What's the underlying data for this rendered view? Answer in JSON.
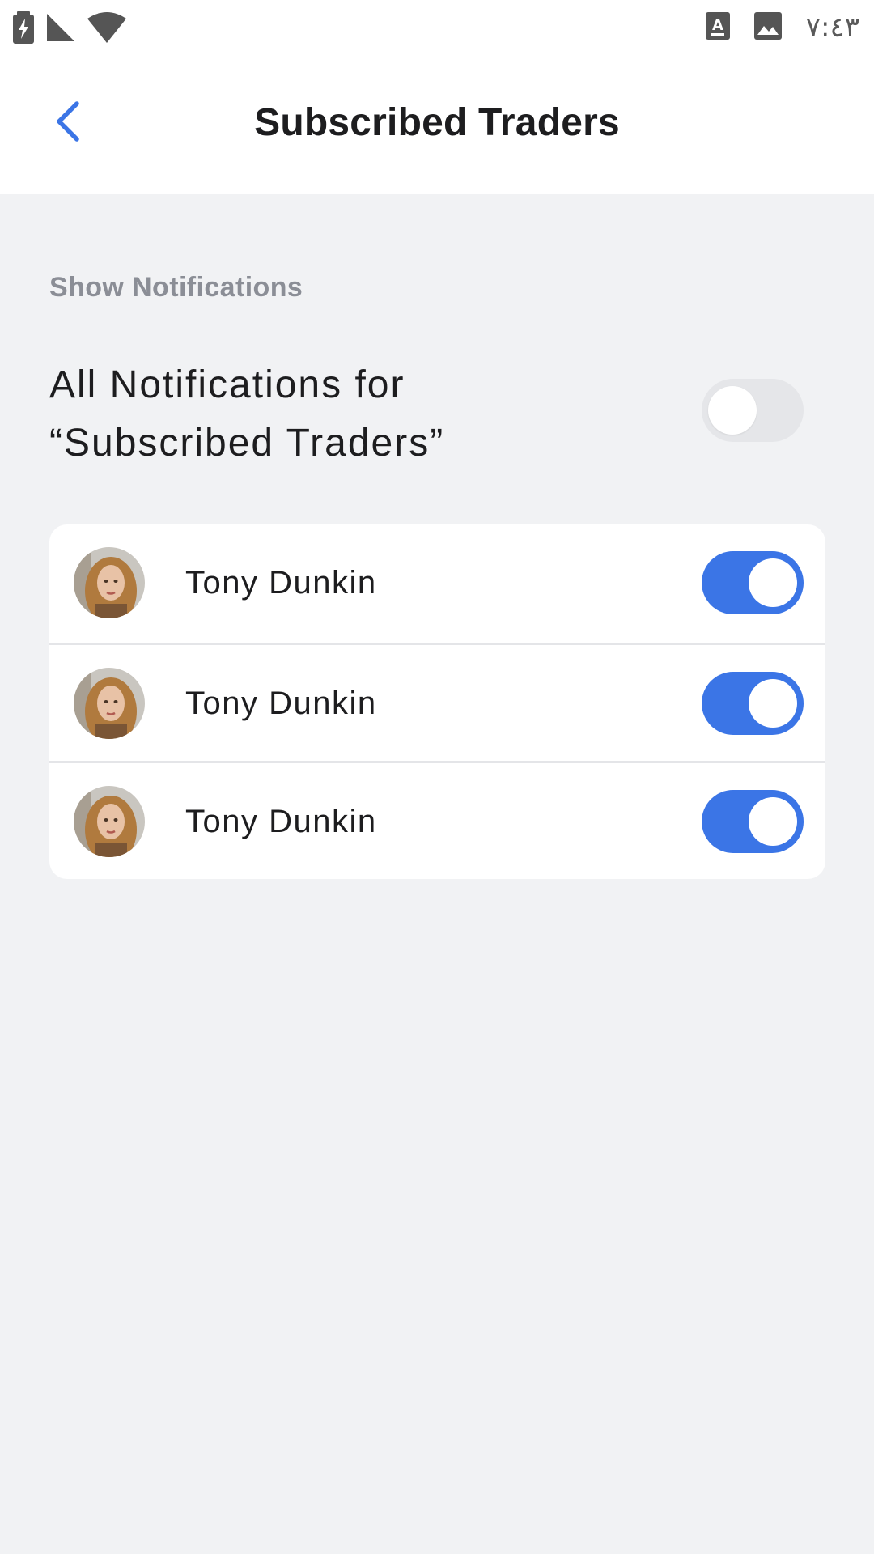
{
  "status_bar": {
    "time": "٧:٤٣",
    "icons": [
      "battery-charging-icon",
      "cell-signal-icon",
      "wifi-icon",
      "keyboard-a-icon",
      "image-icon"
    ]
  },
  "header": {
    "back_icon": "chevron-left-icon",
    "title": "Subscribed Traders"
  },
  "section": {
    "label": "Show Notifications",
    "all_toggle": {
      "line1": "All Notifications for",
      "line2": "“Subscribed Traders”",
      "on": false
    }
  },
  "traders": [
    {
      "name": "Tony Dunkin",
      "on": true
    },
    {
      "name": "Tony Dunkin",
      "on": true
    },
    {
      "name": "Tony Dunkin",
      "on": true
    }
  ],
  "colors": {
    "accent": "#3b75e6",
    "background": "#f1f2f4",
    "toggle_off": "#e5e6e9",
    "section_label": "#8b8e96"
  }
}
